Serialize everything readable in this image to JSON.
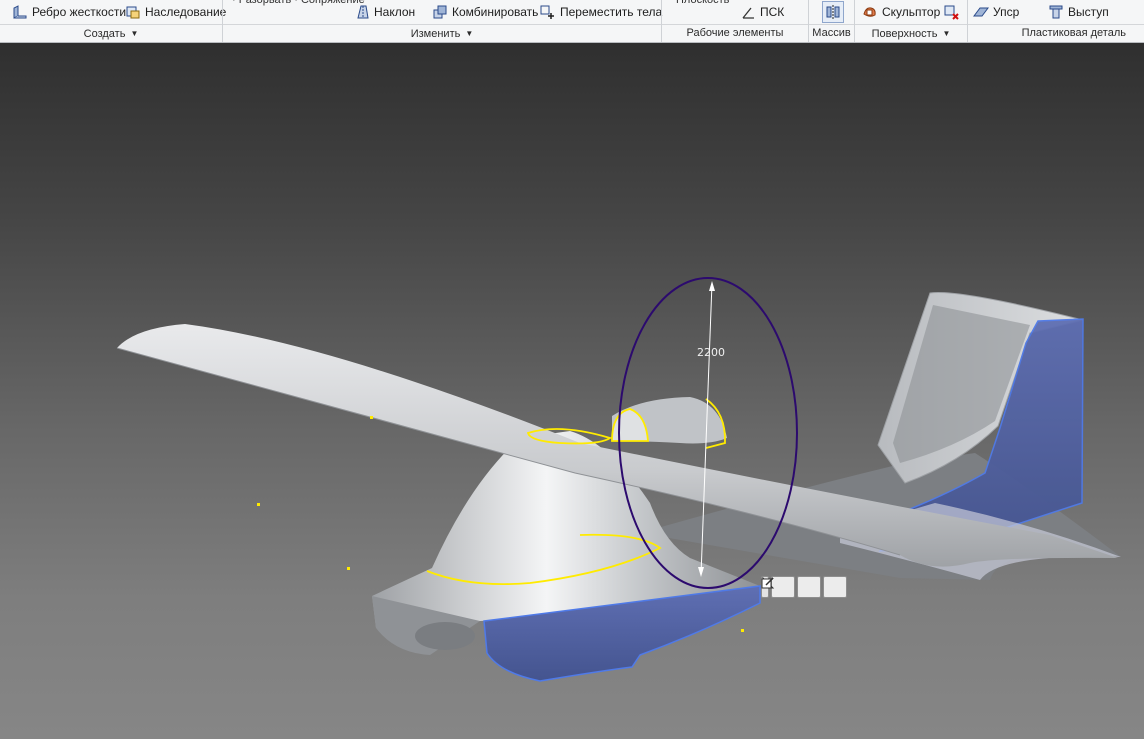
{
  "ribbon": {
    "buttons": {
      "rib": "Ребро жесткости",
      "derive": "Наследование",
      "draft": "Наклон",
      "combine": "Комбинировать",
      "move_bodies": "Переместить тела",
      "ucs": "ПСК",
      "sculpt": "Скульптор",
      "rule": "Упср",
      "boss": "Выступ"
    },
    "panels": {
      "create": "Создать",
      "modify": "Изменить",
      "work_features": "Рабочие элементы",
      "pattern": "Массив",
      "surface": "Поверхность",
      "plastic_part": "Пластиковая деталь"
    }
  },
  "viewport": {
    "dimension_value": "2200"
  },
  "colors": {
    "ribbon_bg": "#f5f6f7",
    "accent_blue": "#3a62c9",
    "highlight_yellow": "#ffeb00",
    "sketch_purple": "#2c0a6e",
    "selection_fill": "#4a5ca3"
  },
  "icons": {
    "rib": "rib-icon",
    "derive": "derive-icon",
    "draft": "draft-icon",
    "combine": "combine-icon",
    "move_bodies": "move-bodies-icon",
    "ucs": "ucs-icon",
    "mirror": "mirror-icon",
    "sculpt": "sculpt-icon",
    "delete_face": "delete-face-icon",
    "rule": "rule-icon",
    "boss": "boss-icon"
  }
}
